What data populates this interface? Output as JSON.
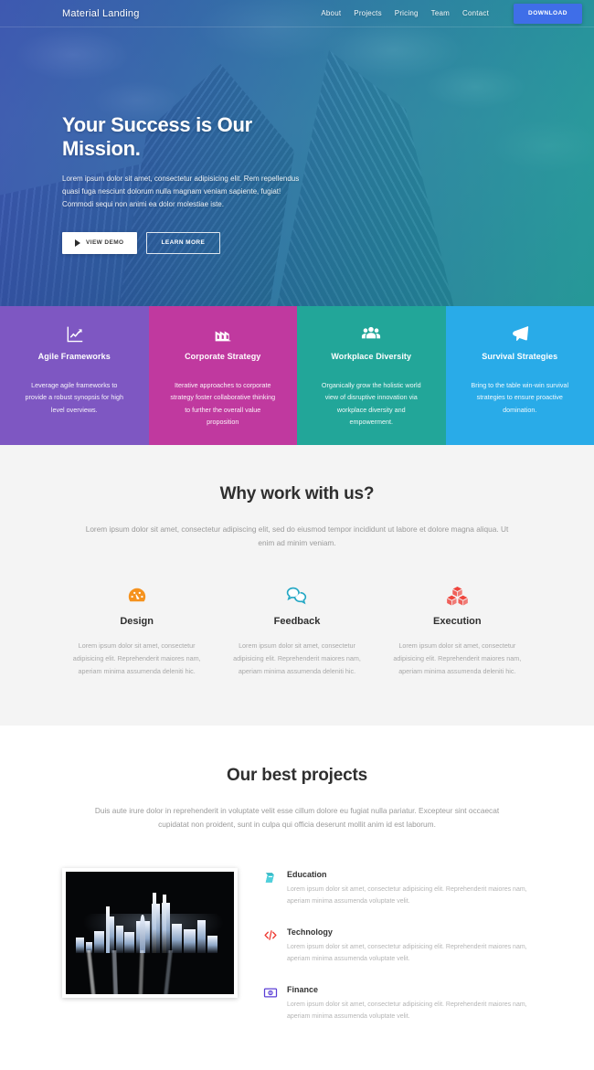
{
  "nav": {
    "brand": "Material Landing",
    "links": [
      {
        "label": "About"
      },
      {
        "label": "Projects"
      },
      {
        "label": "Pricing"
      },
      {
        "label": "Team"
      },
      {
        "label": "Contact"
      }
    ],
    "download_label": "DOWNLOAD",
    "download_color": "#3f6ee8"
  },
  "hero": {
    "title": "Your Success is Our Mission.",
    "subtitle": "Lorem ipsum dolor sit amet, consectetur adipisicing elit. Rem repellendus quasi fuga nesciunt dolorum nulla magnam veniam sapiente, fugiat! Commodi sequi non animi ea dolor molestiae iste.",
    "primary_button": "VIEW DEMO",
    "primary_icon": "play-icon",
    "secondary_button": "LEARN MORE",
    "gradient_from": "#3f58be",
    "gradient_to": "#1cb2a0"
  },
  "cards": [
    {
      "icon": "chart-line-icon",
      "title": "Agile Frameworks",
      "text": "Leverage agile frameworks to provide a robust synopsis for high level overviews.",
      "color": "#7e57c2"
    },
    {
      "icon": "factory-icon",
      "title": "Corporate Strategy",
      "text": "Iterative approaches to corporate strategy foster collaborative thinking to further the overall value proposition",
      "color": "#c0399f"
    },
    {
      "icon": "users-group-icon",
      "title": "Workplace Diversity",
      "text": "Organically grow the holistic world view of disruptive innovation via workplace diversity and empowerment.",
      "color": "#22a699"
    },
    {
      "icon": "megaphone-icon",
      "title": "Survival Strategies",
      "text": "Bring to the table win-win survival strategies to ensure proactive domination.",
      "color": "#29abe8"
    }
  ],
  "why": {
    "title": "Why work with us?",
    "subtitle": "Lorem ipsum dolor sit amet, consectetur adipiscing elit, sed do eiusmod tempor incididunt ut labore et dolore magna aliqua. Ut enim ad minim veniam.",
    "columns": [
      {
        "icon": "gauge-icon",
        "icon_color": "#f5921e",
        "title": "Design",
        "text": "Lorem ipsum dolor sit amet, consectetur adipisicing elit. Reprehenderit maiores nam, aperiam minima assumenda deleniti hic."
      },
      {
        "icon": "speech-bubbles-icon",
        "icon_color": "#23a7c4",
        "title": "Feedback",
        "text": "Lorem ipsum dolor sit amet, consectetur adipisicing elit. Reprehenderit maiores nam, aperiam minima assumenda deleniti hic."
      },
      {
        "icon": "boxes-icon",
        "icon_color": "#ee3b33",
        "title": "Execution",
        "text": "Lorem ipsum dolor sit amet, consectetur adipisicing elit. Reprehenderit maiores nam, aperiam minima assumenda deleniti hic."
      }
    ]
  },
  "projects": {
    "title": "Our best projects",
    "subtitle": "Duis aute irure dolor in reprehenderit in voluptate velit esse cillum dolore eu fugiat nulla pariatur. Excepteur sint occaecat cupidatat non proident, sunt in culpa qui officia deserunt mollit anim id est laborum.",
    "image_alt": "night-city-skyline-photo",
    "items": [
      {
        "icon": "book-icon",
        "icon_color": "#2bb3c0",
        "name": "Education",
        "text": "Lorem ipsum dolor sit amet, consectetur adipisicing elit. Reprehenderit maiores nam, aperiam minima assumenda voluptate velit."
      },
      {
        "icon": "code-icon",
        "icon_color": "#ee3b33",
        "name": "Technology",
        "text": "Lorem ipsum dolor sit amet, consectetur adipisicing elit. Reprehenderit maiores nam, aperiam minima assumenda voluptate velit."
      },
      {
        "icon": "money-icon",
        "icon_color": "#5b3fd6",
        "name": "Finance",
        "text": "Lorem ipsum dolor sit amet, consectetur adipisicing elit. Reprehenderit maiores nam, aperiam minima assumenda voluptate velit."
      }
    ]
  }
}
